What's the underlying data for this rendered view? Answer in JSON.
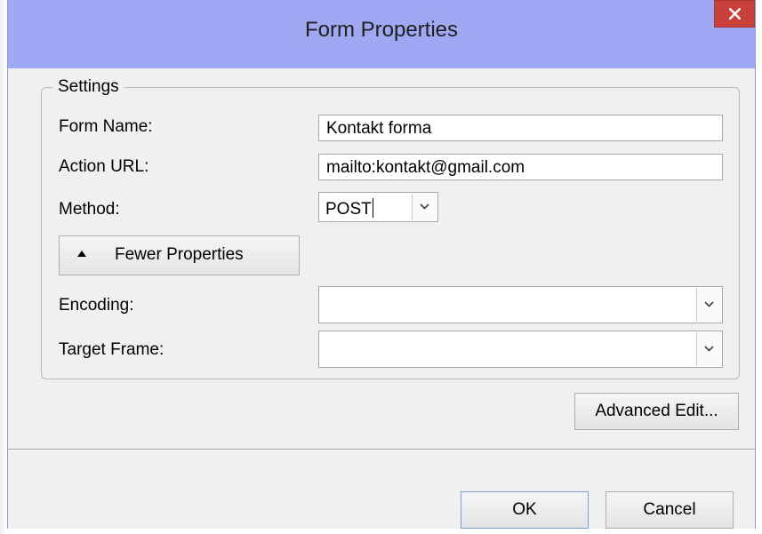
{
  "window": {
    "title": "Form Properties"
  },
  "settings": {
    "legend": "Settings",
    "form_name": {
      "label": "Form Name:",
      "value": "Kontakt forma"
    },
    "action_url": {
      "label": "Action URL:",
      "value": "mailto:kontakt@gmail.com"
    },
    "method": {
      "label": "Method:",
      "value": "POST"
    },
    "fewer_properties_label": "Fewer Properties",
    "encoding": {
      "label": "Encoding:",
      "value": ""
    },
    "target_frame": {
      "label": "Target Frame:",
      "value": ""
    }
  },
  "buttons": {
    "advanced_edit": "Advanced Edit...",
    "ok": "OK",
    "cancel": "Cancel"
  },
  "icons": {
    "close": "close-icon",
    "dropdown": "chevron-down-icon",
    "collapse": "triangle-up-icon"
  },
  "colors": {
    "titlebar": "#9fa8f2",
    "close_button": "#c8413b",
    "dialog_background": "#f0f0f0"
  }
}
